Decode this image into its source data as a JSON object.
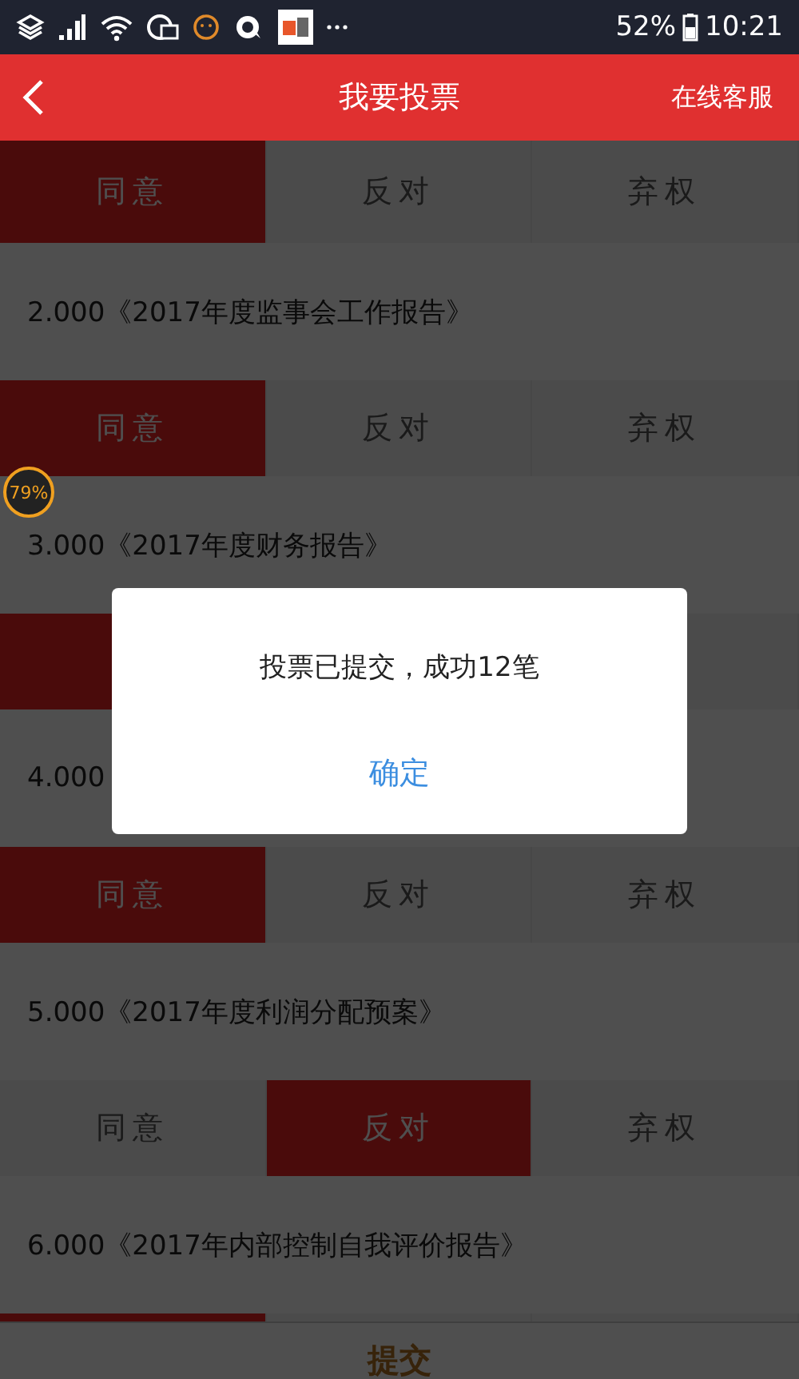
{
  "status_bar": {
    "battery": "52%",
    "time": "10:21"
  },
  "header": {
    "title": "我要投票",
    "action": "在线客服"
  },
  "blocks": [
    {
      "kind": "choices",
      "options": [
        {
          "label": "同意",
          "selected": true
        },
        {
          "label": "反对",
          "selected": false
        },
        {
          "label": "弃权",
          "selected": false
        }
      ]
    },
    {
      "kind": "title",
      "text": "2.000《2017年度监事会工作报告》"
    },
    {
      "kind": "choices",
      "options": [
        {
          "label": "同意",
          "selected": true
        },
        {
          "label": "反对",
          "selected": false
        },
        {
          "label": "弃权",
          "selected": false
        }
      ]
    },
    {
      "kind": "title",
      "text": "3.000《2017年度财务报告》"
    },
    {
      "kind": "choices_covered",
      "left": {
        "selected": true
      },
      "right": {
        "selected": false
      }
    },
    {
      "kind": "title",
      "text": "4.000"
    },
    {
      "kind": "choices",
      "options": [
        {
          "label": "同意",
          "selected": true
        },
        {
          "label": "反对",
          "selected": false
        },
        {
          "label": "弃权",
          "selected": false
        }
      ]
    },
    {
      "kind": "title",
      "text": "5.000《2017年度利润分配预案》"
    },
    {
      "kind": "choices",
      "options": [
        {
          "label": "同意",
          "selected": false
        },
        {
          "label": "反对",
          "selected": true
        },
        {
          "label": "弃权",
          "selected": false
        }
      ]
    },
    {
      "kind": "title",
      "text": "6.000《2017年内部控制自我评价报告》"
    },
    {
      "kind": "choices",
      "options": [
        {
          "selected": true
        },
        {
          "selected": false
        },
        {
          "selected": false
        }
      ]
    }
  ],
  "submit_button": "提交",
  "progress_badge": "79%",
  "dialog": {
    "message": "投票已提交，成功12笔",
    "button": "确定"
  }
}
